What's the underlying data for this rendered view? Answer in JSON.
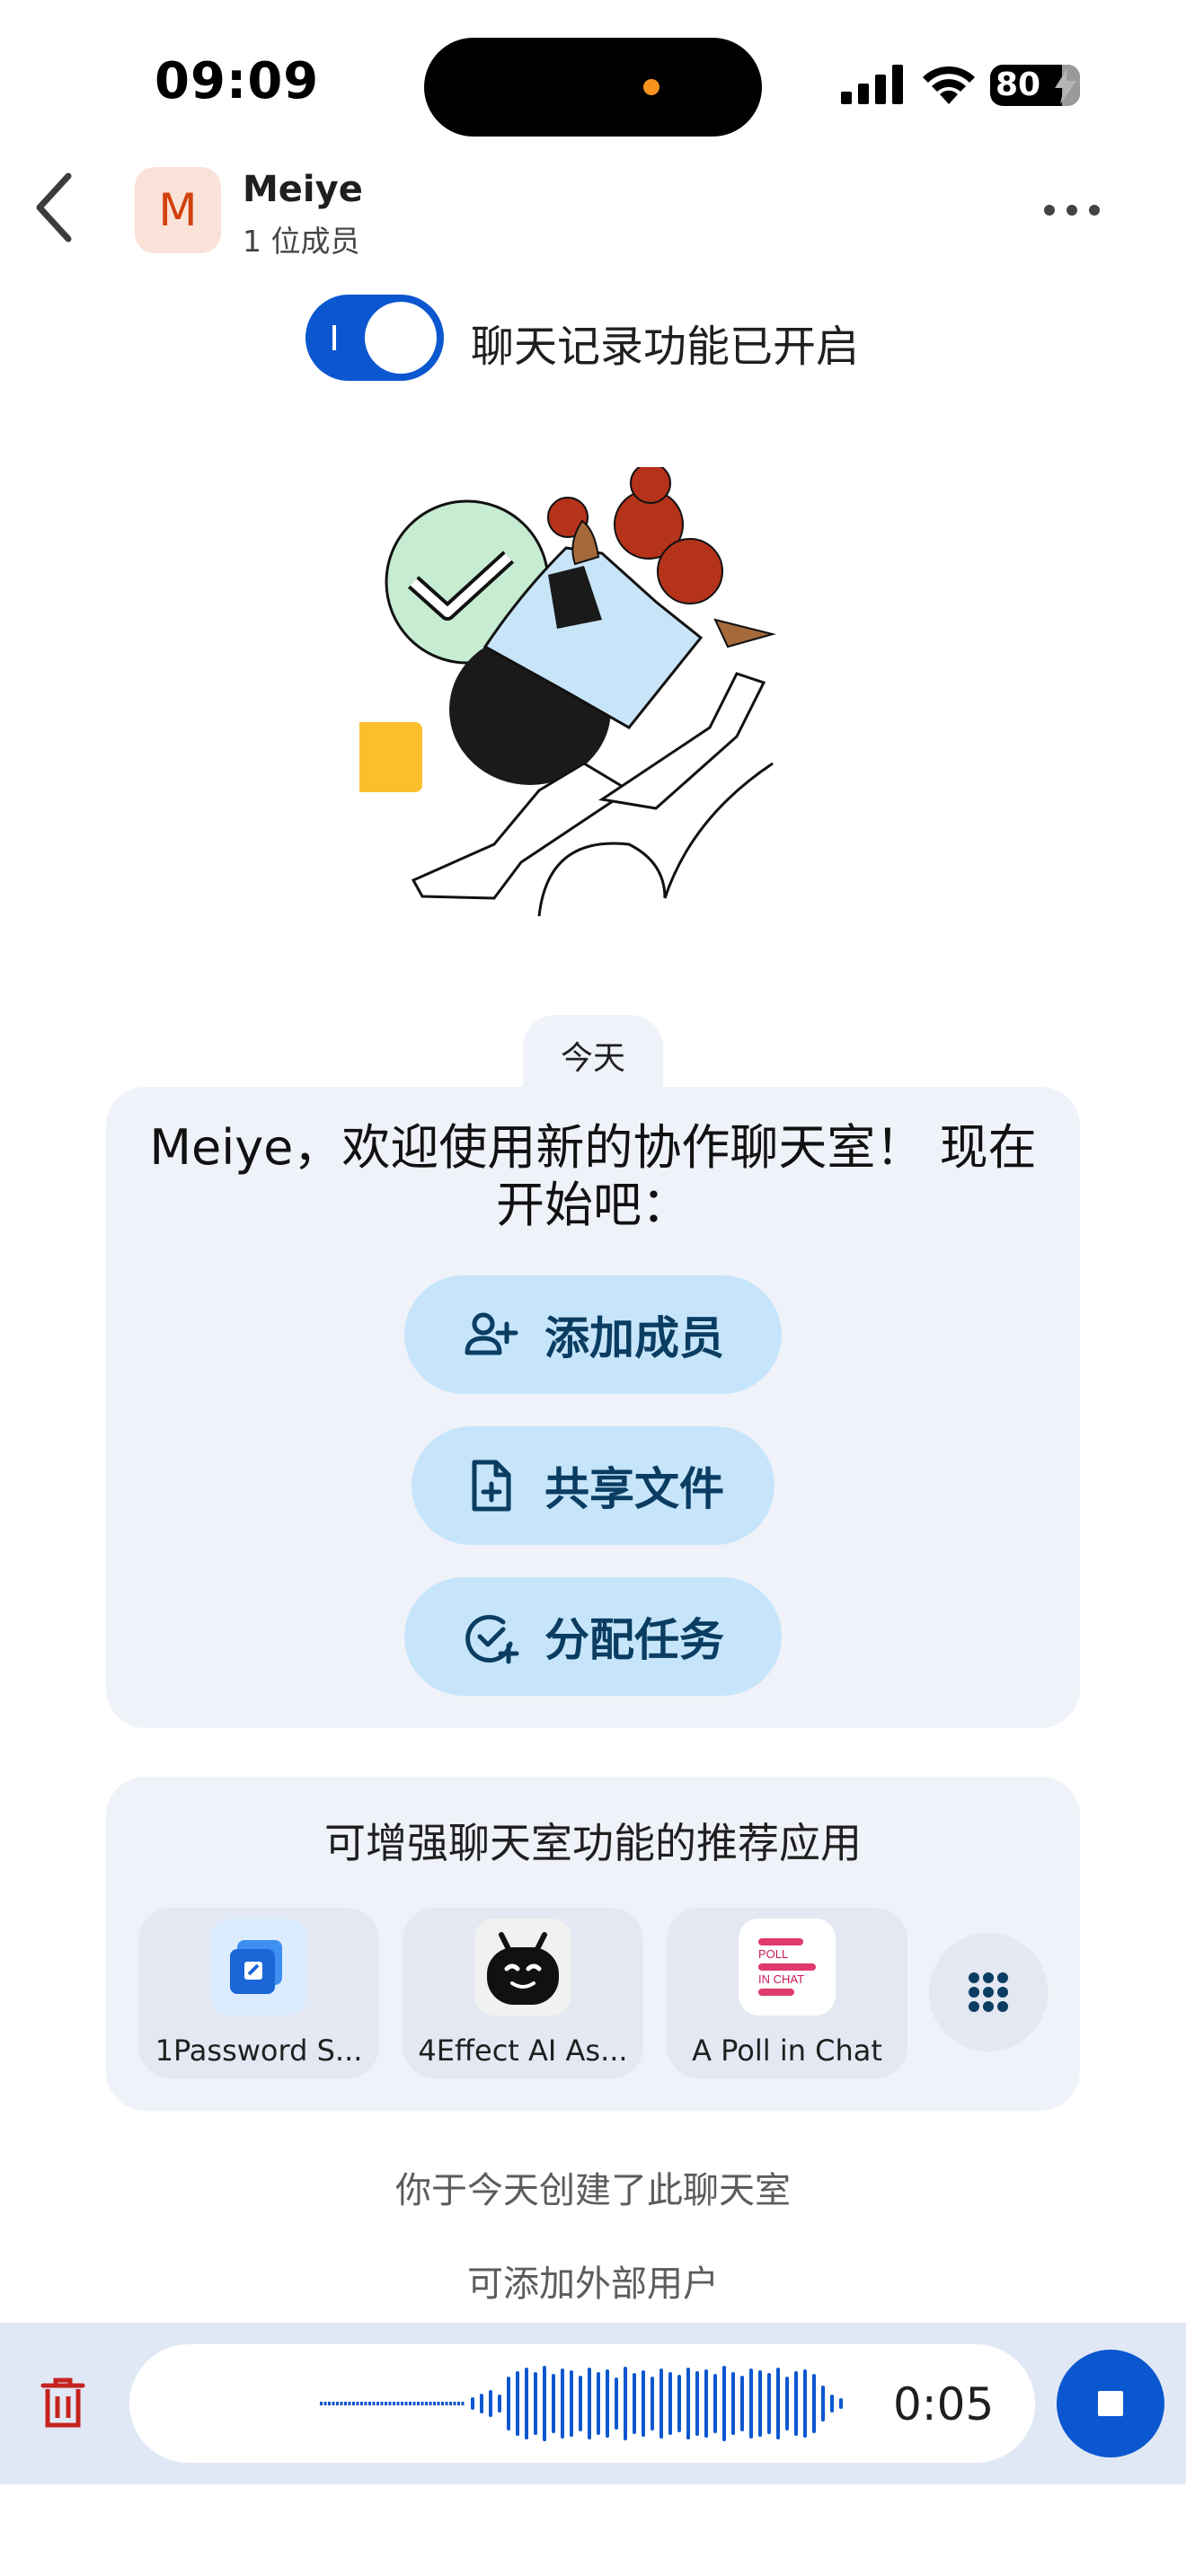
{
  "status_bar": {
    "time": "09:09",
    "battery": "80"
  },
  "header": {
    "avatar_letter": "M",
    "title": "Meiye",
    "subtitle": "1 位成员"
  },
  "history_toggle": {
    "state": "on",
    "label": "聊天记录功能已开启"
  },
  "divider": {
    "date": "今天"
  },
  "welcome": {
    "title": "Meiye，欢迎使用新的协作聊天室！ 现在开始吧：",
    "buttons": [
      {
        "label": "添加成员",
        "icon": "person-add-icon"
      },
      {
        "label": "共享文件",
        "icon": "file-add-icon"
      },
      {
        "label": "分配任务",
        "icon": "task-add-icon"
      }
    ]
  },
  "recommended": {
    "title": "可增强聊天室功能的推荐应用",
    "apps": [
      {
        "label": "1Password S...",
        "icon": "1password-icon"
      },
      {
        "label": "4Effect AI As...",
        "icon": "robot-icon"
      },
      {
        "label": "A Poll in Chat",
        "icon": "poll-icon",
        "icon_text": "POLL IN CHAT"
      }
    ],
    "more_icon": "grid-icon"
  },
  "notes": {
    "created": "你于今天创建了此聊天室",
    "external": "可添加外部用户"
  },
  "recorder": {
    "elapsed": "0:05"
  },
  "colors": {
    "accent": "#0b57d0",
    "avatar_bg": "#fbe2d8",
    "avatar_fg": "#d1410c",
    "pill_bg": "#c6e5fb",
    "card_bg": "#eff2f8"
  }
}
